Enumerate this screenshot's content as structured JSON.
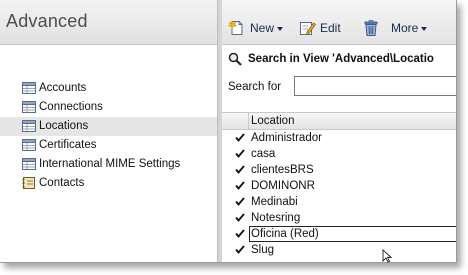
{
  "left_panel": {
    "title": "Advanced",
    "items": [
      {
        "label": "Accounts",
        "icon": "table-icon"
      },
      {
        "label": "Connections",
        "icon": "table-icon"
      },
      {
        "label": "Locations",
        "icon": "table-icon",
        "selected": true
      },
      {
        "label": "Certificates",
        "icon": "table-icon"
      },
      {
        "label": "International MIME Settings",
        "icon": "table-icon"
      },
      {
        "label": "Contacts",
        "icon": "address-book-icon"
      }
    ]
  },
  "toolbar": {
    "new_label": "New",
    "edit_label": "Edit",
    "more_label": "More"
  },
  "search": {
    "title": "Search in View 'Advanced\\Locatio",
    "label": "Search for",
    "value": ""
  },
  "list": {
    "column_header": "Location",
    "rows": [
      {
        "name": "Administrador",
        "checked": true
      },
      {
        "name": "casa",
        "checked": true
      },
      {
        "name": "clientesBRS",
        "checked": true
      },
      {
        "name": "DOMINONR",
        "checked": true
      },
      {
        "name": "Medinabi",
        "checked": true
      },
      {
        "name": "Notesring",
        "checked": true
      },
      {
        "name": "Oficina (Red)",
        "checked": true,
        "focused": true
      },
      {
        "name": "Slug",
        "checked": true
      }
    ]
  },
  "colors": {
    "header_text": "#4d4d4d",
    "selected_row": "#e6e6e6",
    "toolbar_text": "#1a2a4a"
  }
}
